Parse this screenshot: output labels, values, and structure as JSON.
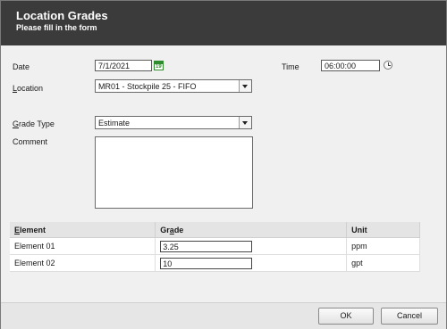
{
  "header": {
    "title": "Location Grades",
    "subtitle": "Please fill in the form"
  },
  "form": {
    "date_label": "Date",
    "date_value": "7/1/2021",
    "calendar_icon_text": "19",
    "time_label": "Time",
    "time_value": "06:00:00",
    "location_label_first": "L",
    "location_label_rest": "ocation",
    "location_value": "MR01 - Stockpile 25 - FIFO",
    "grade_type_label_first": "G",
    "grade_type_label_rest": "rade Type",
    "grade_type_value": "Estimate",
    "comment_label": "Comment",
    "comment_value": ""
  },
  "grid": {
    "headers": {
      "element_first": "E",
      "element_rest": "lement",
      "grade_pre": "Gr",
      "grade_u": "a",
      "grade_post": "de",
      "unit": "Unit"
    },
    "rows": [
      {
        "element": "Element 01",
        "grade": "3.25",
        "unit": "ppm"
      },
      {
        "element": "Element 02",
        "grade": "10",
        "unit": "gpt"
      }
    ]
  },
  "footer": {
    "ok_label": "OK",
    "cancel_label": "Cancel"
  }
}
